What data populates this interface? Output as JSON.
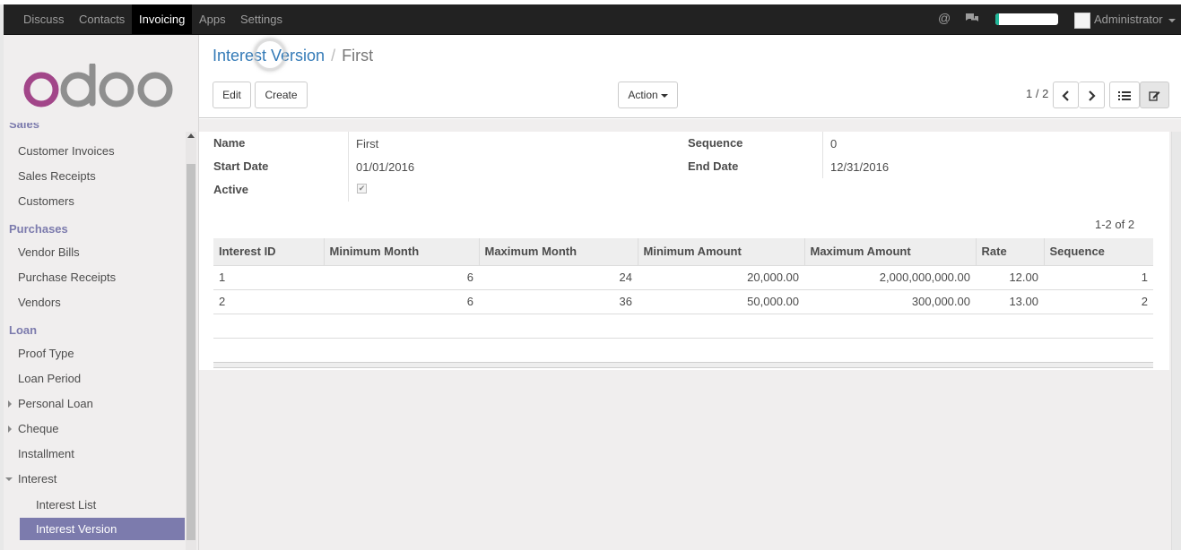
{
  "topbar": {
    "menu": [
      {
        "label": "Discuss",
        "active": false
      },
      {
        "label": "Contacts",
        "active": false
      },
      {
        "label": "Invoicing",
        "active": true
      },
      {
        "label": "Apps",
        "active": false
      },
      {
        "label": "Settings",
        "active": false
      }
    ],
    "icons": [
      "at-icon",
      "chat-bubbles-icon"
    ],
    "progress_fraction": 0.05,
    "user": "Administrator",
    "colors": {
      "bar": "#222222",
      "progress": "#21b799"
    }
  },
  "sidebar": {
    "logo_text": "odoo",
    "sections": [
      {
        "heading": "Sales",
        "items": [
          "Customer Invoices",
          "Sales Receipts",
          "Customers"
        ]
      },
      {
        "heading": "Purchases",
        "items": [
          "Vendor Bills",
          "Purchase Receipts",
          "Vendors"
        ]
      },
      {
        "heading": "Loan",
        "items": [
          "Proof Type",
          "Loan Period",
          "Personal Loan",
          "Cheque",
          "Installment",
          "Interest"
        ],
        "sub_items": [
          "Interest List",
          "Interest Version"
        ]
      }
    ],
    "active_item": "Interest Version",
    "accent_color": "#7c7bad"
  },
  "control": {
    "breadcrumb": {
      "parent": "Interest Version",
      "separator": "/",
      "current": "First"
    },
    "buttons": {
      "edit": "Edit",
      "create": "Create",
      "action": "Action"
    },
    "pager": "1 / 2"
  },
  "form": {
    "name_label": "Name",
    "name_value": "First",
    "start_label": "Start Date",
    "start_value": "01/01/2016",
    "active_label": "Active",
    "active_checked": true,
    "sequence_label": "Sequence",
    "sequence_value": "0",
    "end_label": "End Date",
    "end_value": "12/31/2016"
  },
  "lines": {
    "record_count": "1-2 of 2",
    "columns": [
      "Interest ID",
      "Minimum Month",
      "Maximum Month",
      "Minimum Amount",
      "Maximum Amount",
      "Rate",
      "Sequence"
    ],
    "rows": [
      [
        "1",
        "6",
        "24",
        "20,000.00",
        "2,000,000,000.00",
        "12.00",
        "1"
      ],
      [
        "2",
        "6",
        "36",
        "50,000.00",
        "300,000.00",
        "13.00",
        "2"
      ]
    ]
  }
}
